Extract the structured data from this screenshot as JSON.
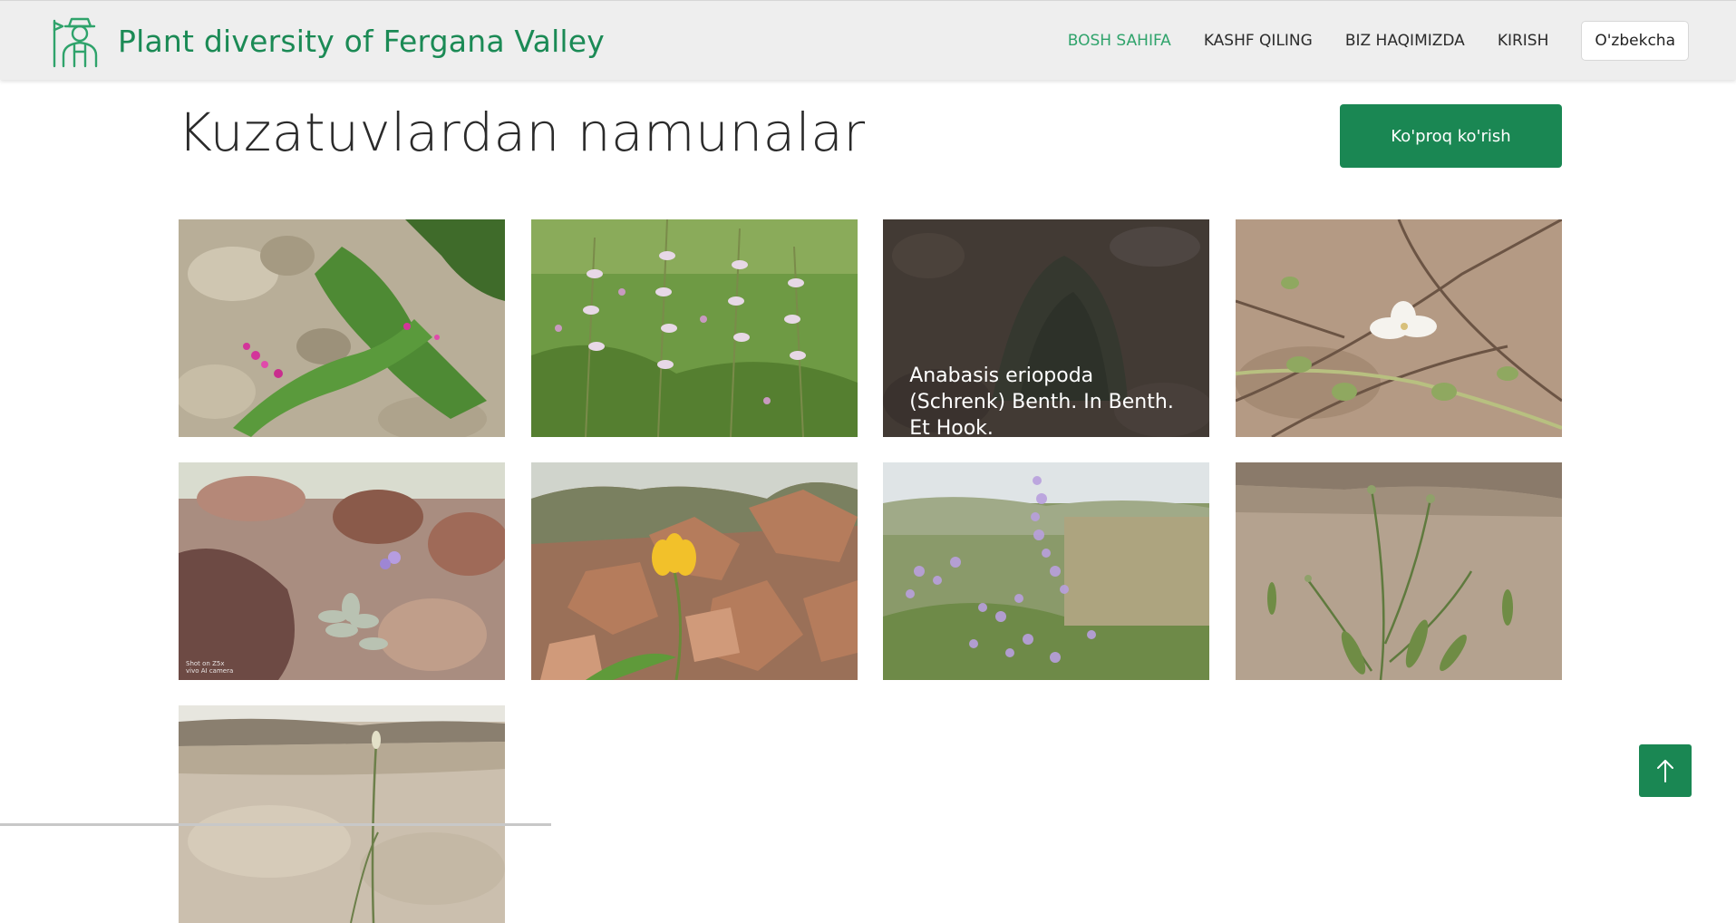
{
  "brand": {
    "logo_icon": "gardener-icon",
    "title": "Plant diversity of Fergana Valley",
    "color": "#1b8a55"
  },
  "nav": {
    "items": [
      {
        "label": "BOSH SAHIFA",
        "active": true
      },
      {
        "label": "KASHF QILING",
        "active": false
      },
      {
        "label": "BIZ HAQIMIZDA",
        "active": false
      },
      {
        "label": "KIRISH",
        "active": false
      }
    ],
    "language": "O'zbekcha"
  },
  "section": {
    "title": "Kuzatuvlardan namunalar",
    "more_button": "Ko'proq ko'rish",
    "accent": "#1a8753"
  },
  "observations": [
    {
      "photo": "pink-flowers-on-rocky-soil"
    },
    {
      "photo": "white-sage-flowers-in-grass"
    },
    {
      "photo": "grey-shrub-on-stones",
      "caption": "Anabasis eriopoda (Schrenk) Benth. In Benth. Et Hook."
    },
    {
      "photo": "white-caper-flower-on-branches"
    },
    {
      "photo": "silver-plant-among-red-rocks",
      "camera_text": "Shot on Z5x\nvivo AI camera"
    },
    {
      "photo": "yellow-tulip-in-rocks"
    },
    {
      "photo": "purple-limonium-meadow"
    },
    {
      "photo": "slender-plant-on-sand"
    },
    {
      "photo": "plant-on-sandy-cliff"
    }
  ],
  "scroll_top": {
    "icon": "arrow-up-icon"
  }
}
